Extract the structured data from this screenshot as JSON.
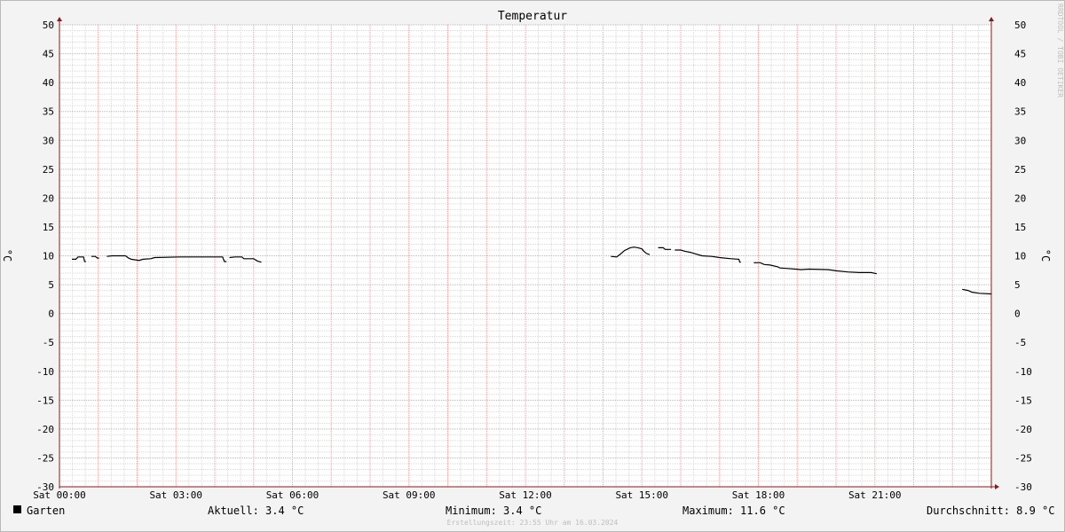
{
  "chart_data": {
    "type": "line",
    "title": "Temperatur",
    "ylabel": "°C",
    "ylabel_right": "°C",
    "ylim": [
      -30,
      50
    ],
    "yticks": [
      50,
      45,
      40,
      35,
      30,
      25,
      20,
      15,
      10,
      5,
      0,
      -5,
      -10,
      -15,
      -20,
      -25,
      -30
    ],
    "xlim": [
      "Sat 00:00",
      "Sun 00:00"
    ],
    "xticks": [
      {
        "h": 0,
        "label": "Sat 00:00"
      },
      {
        "h": 3,
        "label": "Sat 03:00"
      },
      {
        "h": 6,
        "label": "Sat 06:00"
      },
      {
        "h": 9,
        "label": "Sat 09:00"
      },
      {
        "h": 12,
        "label": "Sat 12:00"
      },
      {
        "h": 15,
        "label": "Sat 15:00"
      },
      {
        "h": 18,
        "label": "Sat 18:00"
      },
      {
        "h": 21,
        "label": "Sat 21:00"
      }
    ],
    "grid": true,
    "series": [
      {
        "name": "Garten",
        "color": "#000000",
        "segments": [
          [
            [
              0.32,
              9.4
            ],
            [
              0.42,
              9.4
            ],
            [
              0.48,
              9.8
            ],
            [
              0.62,
              9.8
            ],
            [
              0.65,
              9.0
            ],
            [
              0.68,
              9.0
            ]
          ],
          [
            [
              0.82,
              9.9
            ],
            [
              0.92,
              9.9
            ],
            [
              0.98,
              9.6
            ],
            [
              1.02,
              9.6
            ]
          ],
          [
            [
              1.22,
              9.9
            ],
            [
              1.35,
              10.0
            ],
            [
              1.7,
              10.0
            ],
            [
              1.78,
              9.6
            ],
            [
              1.85,
              9.4
            ],
            [
              2.05,
              9.2
            ],
            [
              2.15,
              9.4
            ],
            [
              2.35,
              9.5
            ],
            [
              2.45,
              9.7
            ],
            [
              3.1,
              9.8
            ],
            [
              4.2,
              9.8
            ],
            [
              4.25,
              9.0
            ],
            [
              4.3,
              9.0
            ]
          ],
          [
            [
              4.38,
              9.7
            ],
            [
              4.52,
              9.8
            ],
            [
              4.7,
              9.8
            ],
            [
              4.75,
              9.5
            ],
            [
              5.0,
              9.5
            ],
            [
              5.1,
              9.1
            ],
            [
              5.2,
              8.9
            ]
          ],
          [
            [
              14.2,
              9.9
            ],
            [
              14.35,
              9.8
            ],
            [
              14.45,
              10.3
            ],
            [
              14.55,
              10.9
            ],
            [
              14.7,
              11.4
            ],
            [
              14.8,
              11.5
            ],
            [
              14.9,
              11.4
            ],
            [
              15.0,
              11.2
            ],
            [
              15.05,
              10.8
            ],
            [
              15.12,
              10.4
            ],
            [
              15.2,
              10.2
            ]
          ],
          [
            [
              15.42,
              11.4
            ],
            [
              15.55,
              11.4
            ],
            [
              15.6,
              11.1
            ],
            [
              15.75,
              11.1
            ]
          ],
          [
            [
              15.85,
              11.0
            ],
            [
              16.0,
              11.0
            ],
            [
              16.1,
              10.8
            ],
            [
              16.25,
              10.6
            ],
            [
              16.35,
              10.4
            ],
            [
              16.55,
              10.0
            ],
            [
              16.8,
              9.9
            ],
            [
              17.0,
              9.7
            ],
            [
              17.3,
              9.5
            ],
            [
              17.5,
              9.4
            ],
            [
              17.52,
              8.9
            ],
            [
              17.55,
              8.9
            ]
          ],
          [
            [
              17.88,
              8.8
            ],
            [
              18.05,
              8.8
            ],
            [
              18.15,
              8.5
            ],
            [
              18.3,
              8.4
            ],
            [
              18.5,
              8.1
            ],
            [
              18.55,
              7.9
            ],
            [
              18.75,
              7.8
            ],
            [
              18.95,
              7.7
            ],
            [
              19.1,
              7.6
            ],
            [
              19.3,
              7.7
            ],
            [
              19.8,
              7.6
            ],
            [
              20.0,
              7.4
            ],
            [
              20.3,
              7.2
            ],
            [
              20.6,
              7.1
            ],
            [
              20.9,
              7.1
            ],
            [
              21.05,
              6.9
            ]
          ],
          [
            [
              23.25,
              4.2
            ],
            [
              23.4,
              4.0
            ],
            [
              23.5,
              3.7
            ],
            [
              23.7,
              3.5
            ],
            [
              24.0,
              3.4
            ]
          ]
        ]
      }
    ],
    "legend": "bottom-left"
  },
  "legend": {
    "name": "Garten",
    "current": "Aktuell: 3.4 °C",
    "minimum": "Minimum: 3.4 °C",
    "maximum": "Maximum: 11.6 °C",
    "average": "Durchschnitt: 8.9 °C"
  },
  "watermark": "RRDTOOL / TOBI OETIKER",
  "footer": "Erstellungszeit: 23:55 Uhr am 16.03.2024",
  "colors": {
    "grid_major": "#e8a0a0",
    "grid_minor": "#d8d8d8",
    "axis": "#8b1a1a",
    "background": "#f3f3f3",
    "plot_background": "#ffffff"
  }
}
